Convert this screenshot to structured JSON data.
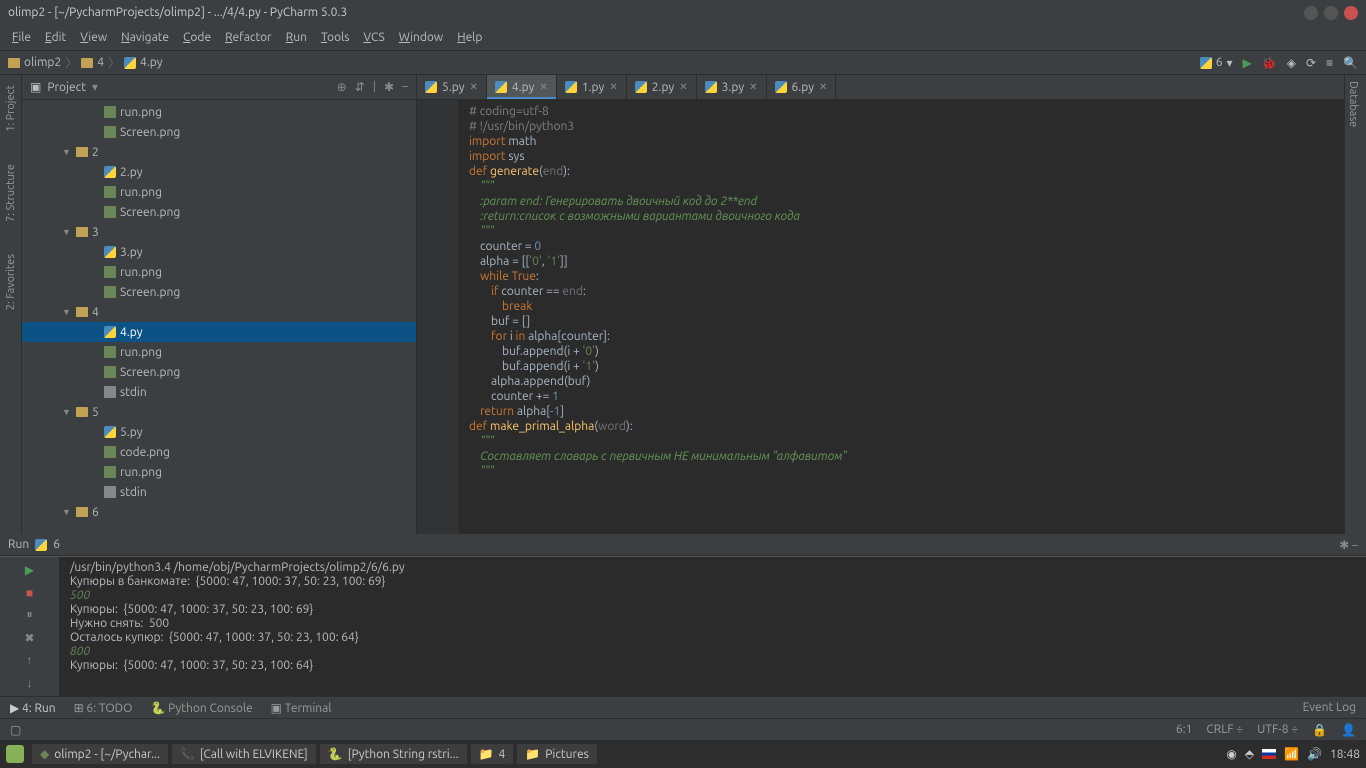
{
  "title": "olimp2 - [~/PycharmProjects/olimp2] - .../4/4.py - PyCharm 5.0.3",
  "menu": [
    "File",
    "Edit",
    "View",
    "Navigate",
    "Code",
    "Refactor",
    "Run",
    "Tools",
    "VCS",
    "Window",
    "Help"
  ],
  "breadcrumb": [
    {
      "icon": "folder",
      "label": "olimp2"
    },
    {
      "icon": "folder",
      "label": "4"
    },
    {
      "icon": "py",
      "label": "4.py"
    }
  ],
  "runConfig": "6",
  "sideTabs": [
    "1: Project",
    "7: Structure",
    "2: Favorites"
  ],
  "rightTab": "Database",
  "panel": {
    "title": "Project",
    "tools": [
      "⊕",
      "⇵",
      "|",
      "✱",
      "–"
    ]
  },
  "tree": [
    {
      "d": 4,
      "ic": "img",
      "n": "run.png"
    },
    {
      "d": 4,
      "ic": "img",
      "n": "Screen.png"
    },
    {
      "d": 2,
      "ic": "folder",
      "n": "2",
      "exp": true
    },
    {
      "d": 4,
      "ic": "py",
      "n": "2.py"
    },
    {
      "d": 4,
      "ic": "img",
      "n": "run.png"
    },
    {
      "d": 4,
      "ic": "img",
      "n": "Screen.png"
    },
    {
      "d": 2,
      "ic": "folder",
      "n": "3",
      "exp": true
    },
    {
      "d": 4,
      "ic": "py",
      "n": "3.py"
    },
    {
      "d": 4,
      "ic": "img",
      "n": "run.png"
    },
    {
      "d": 4,
      "ic": "img",
      "n": "Screen.png"
    },
    {
      "d": 2,
      "ic": "folder",
      "n": "4",
      "exp": true
    },
    {
      "d": 4,
      "ic": "py",
      "n": "4.py",
      "sel": true
    },
    {
      "d": 4,
      "ic": "img",
      "n": "run.png"
    },
    {
      "d": 4,
      "ic": "img",
      "n": "Screen.png"
    },
    {
      "d": 4,
      "ic": "file",
      "n": "stdin"
    },
    {
      "d": 2,
      "ic": "folder",
      "n": "5",
      "exp": true
    },
    {
      "d": 4,
      "ic": "py",
      "n": "5.py"
    },
    {
      "d": 4,
      "ic": "img",
      "n": "code.png"
    },
    {
      "d": 4,
      "ic": "img",
      "n": "run.png"
    },
    {
      "d": 4,
      "ic": "file",
      "n": "stdin"
    },
    {
      "d": 2,
      "ic": "folder",
      "n": "6",
      "exp": true
    }
  ],
  "tabs": [
    {
      "label": "5.py"
    },
    {
      "label": "4.py",
      "active": true
    },
    {
      "label": "1.py"
    },
    {
      "label": "2.py"
    },
    {
      "label": "3.py"
    },
    {
      "label": "6.py"
    }
  ],
  "code": [
    [
      [
        "cm",
        "# coding=utf-8"
      ]
    ],
    [
      [
        "cm",
        "# !/usr/bin/python3"
      ]
    ],
    [
      [
        "kw",
        "import"
      ],
      [
        "t",
        " math"
      ]
    ],
    [
      [
        "kw",
        "import"
      ],
      [
        "t",
        " sys"
      ]
    ],
    [
      [
        "t",
        ""
      ]
    ],
    [
      [
        "t",
        ""
      ]
    ],
    [
      [
        "kw",
        "def "
      ],
      [
        "fn",
        "generate"
      ],
      [
        "t",
        "("
      ],
      [
        "par",
        "end"
      ],
      [
        "t",
        "):"
      ]
    ],
    [
      [
        "doc",
        "    \"\"\""
      ]
    ],
    [
      [
        "doc",
        "    :param end: Генерировать двоичный код до 2**end"
      ]
    ],
    [
      [
        "doc",
        "    :return:список с возможными вариантами двоичного кода"
      ]
    ],
    [
      [
        "doc",
        "    \"\"\""
      ]
    ],
    [
      [
        "t",
        "    counter = "
      ],
      [
        "num",
        "0"
      ]
    ],
    [
      [
        "t",
        "    alpha = [["
      ],
      [
        "str",
        "'0'"
      ],
      [
        "t",
        ", "
      ],
      [
        "str",
        "'1'"
      ],
      [
        "t",
        "]]"
      ]
    ],
    [
      [
        "t",
        "    "
      ],
      [
        "kw",
        "while "
      ],
      [
        "kw",
        "True"
      ],
      [
        "t",
        ":"
      ]
    ],
    [
      [
        "t",
        "        "
      ],
      [
        "kw",
        "if"
      ],
      [
        "t",
        " counter == "
      ],
      [
        "par",
        "end"
      ],
      [
        "t",
        ":"
      ]
    ],
    [
      [
        "t",
        "            "
      ],
      [
        "kw",
        "break"
      ]
    ],
    [
      [
        "t",
        "        buf = []"
      ]
    ],
    [
      [
        "t",
        "        "
      ],
      [
        "kw",
        "for"
      ],
      [
        "t",
        " i "
      ],
      [
        "kw",
        "in"
      ],
      [
        "t",
        " alpha[counter]:"
      ]
    ],
    [
      [
        "t",
        "            buf.append(i + "
      ],
      [
        "str",
        "'0'"
      ],
      [
        "t",
        ")"
      ]
    ],
    [
      [
        "t",
        "            buf.append(i + "
      ],
      [
        "str",
        "'1'"
      ],
      [
        "t",
        ")"
      ]
    ],
    [
      [
        "t",
        "        alpha.append(buf)"
      ]
    ],
    [
      [
        "t",
        "        counter += "
      ],
      [
        "num",
        "1"
      ]
    ],
    [
      [
        "t",
        "    "
      ],
      [
        "kw",
        "return"
      ],
      [
        "t",
        " alpha["
      ],
      [
        "num",
        "-1"
      ],
      [
        "t",
        "]"
      ]
    ],
    [
      [
        "t",
        ""
      ]
    ],
    [
      [
        "t",
        ""
      ]
    ],
    [
      [
        "kw",
        "def "
      ],
      [
        "fn",
        "make_primal_alpha"
      ],
      [
        "t",
        "("
      ],
      [
        "par",
        "word"
      ],
      [
        "t",
        "):"
      ]
    ],
    [
      [
        "doc",
        "    \"\"\""
      ]
    ],
    [
      [
        "doc",
        "    Составляет словарь с первичным НЕ минимальным \"алфавитом\""
      ]
    ],
    [
      [
        "doc",
        "    \"\"\""
      ]
    ]
  ],
  "run": {
    "title": "Run",
    "config": "6",
    "lines": [
      {
        "c": "out",
        "t": "/usr/bin/python3.4 /home/obj/PycharmProjects/olimp2/6/6.py"
      },
      {
        "c": "out",
        "t": "Купюры в банкомате:  {5000: 47, 1000: 37, 50: 23, 100: 69}"
      },
      {
        "c": "inp",
        "t": "500"
      },
      {
        "c": "out",
        "t": "Купюры:  {5000: 47, 1000: 37, 50: 23, 100: 69}"
      },
      {
        "c": "out",
        "t": "Нужно снять:  500"
      },
      {
        "c": "out",
        "t": "Осталось купюр:  {5000: 47, 1000: 37, 50: 23, 100: 64}"
      },
      {
        "c": "inp",
        "t": "800"
      },
      {
        "c": "out",
        "t": "Купюры:  {5000: 47, 1000: 37, 50: 23, 100: 64}"
      }
    ]
  },
  "bottomTabs": [
    "▶ 4: Run",
    "⊞ 6: TODO",
    "🐍 Python Console",
    "▣ Terminal"
  ],
  "eventLog": "Event Log",
  "status": {
    "pos": "6:1",
    "eol": "CRLF ÷",
    "enc": "UTF-8 ÷",
    "lock": "🔒"
  },
  "taskbar": {
    "items": [
      "olimp2 - [~/Pychar...",
      "[Call with ELVIKENE]",
      "[Python String rstri...",
      "4",
      "Pictures"
    ],
    "time": "18:48"
  }
}
